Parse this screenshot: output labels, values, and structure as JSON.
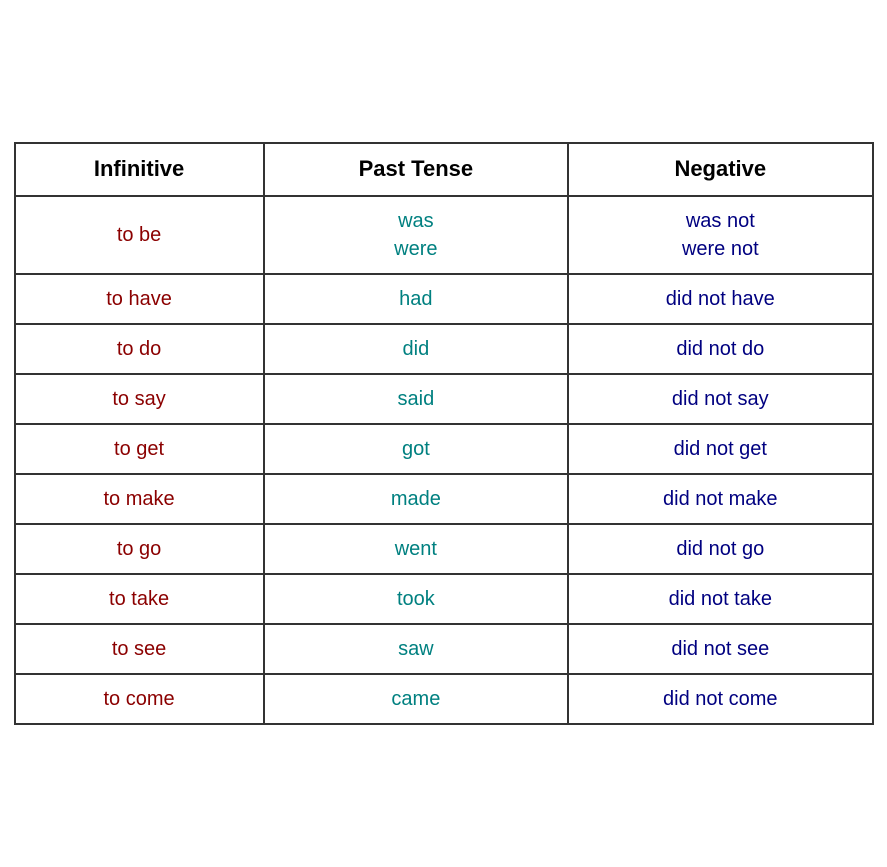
{
  "table": {
    "headers": {
      "col1": "Infinitive",
      "col2": "Past Tense",
      "col3": "Negative"
    },
    "rows": [
      {
        "infinitive": "to be",
        "past_tense": "was\nwere",
        "negative": "was not\nwere not"
      },
      {
        "infinitive": "to have",
        "past_tense": "had",
        "negative": "did not have"
      },
      {
        "infinitive": "to do",
        "past_tense": "did",
        "negative": "did not do"
      },
      {
        "infinitive": "to say",
        "past_tense": "said",
        "negative": "did not say"
      },
      {
        "infinitive": "to get",
        "past_tense": "got",
        "negative": "did not get"
      },
      {
        "infinitive": "to make",
        "past_tense": "made",
        "negative": "did not make"
      },
      {
        "infinitive": "to go",
        "past_tense": "went",
        "negative": "did not go"
      },
      {
        "infinitive": "to take",
        "past_tense": "took",
        "negative": "did not take"
      },
      {
        "infinitive": "to see",
        "past_tense": "saw",
        "negative": "did not see"
      },
      {
        "infinitive": "to come",
        "past_tense": "came",
        "negative": "did not come"
      }
    ]
  }
}
